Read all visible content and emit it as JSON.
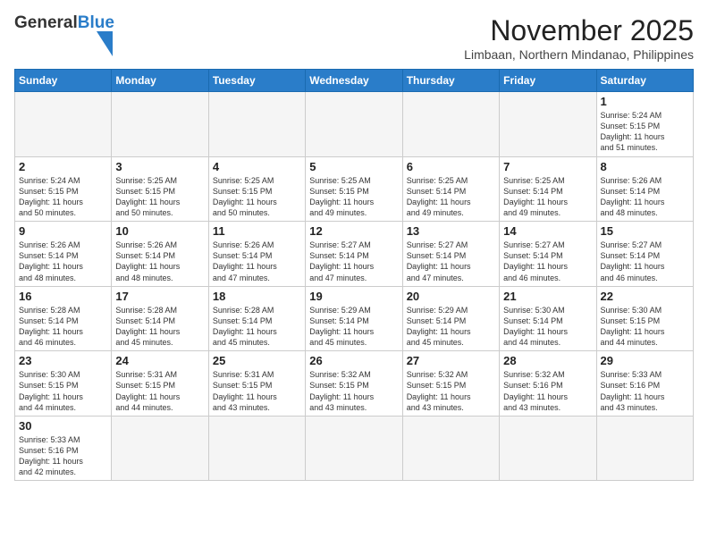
{
  "header": {
    "logo_general": "General",
    "logo_blue": "Blue",
    "month_title": "November 2025",
    "location": "Limbaan, Northern Mindanao, Philippines"
  },
  "weekdays": [
    "Sunday",
    "Monday",
    "Tuesday",
    "Wednesday",
    "Thursday",
    "Friday",
    "Saturday"
  ],
  "weeks": [
    [
      {
        "day": "",
        "info": ""
      },
      {
        "day": "",
        "info": ""
      },
      {
        "day": "",
        "info": ""
      },
      {
        "day": "",
        "info": ""
      },
      {
        "day": "",
        "info": ""
      },
      {
        "day": "",
        "info": ""
      },
      {
        "day": "1",
        "info": "Sunrise: 5:24 AM\nSunset: 5:15 PM\nDaylight: 11 hours\nand 51 minutes."
      }
    ],
    [
      {
        "day": "2",
        "info": "Sunrise: 5:24 AM\nSunset: 5:15 PM\nDaylight: 11 hours\nand 50 minutes."
      },
      {
        "day": "3",
        "info": "Sunrise: 5:25 AM\nSunset: 5:15 PM\nDaylight: 11 hours\nand 50 minutes."
      },
      {
        "day": "4",
        "info": "Sunrise: 5:25 AM\nSunset: 5:15 PM\nDaylight: 11 hours\nand 50 minutes."
      },
      {
        "day": "5",
        "info": "Sunrise: 5:25 AM\nSunset: 5:15 PM\nDaylight: 11 hours\nand 49 minutes."
      },
      {
        "day": "6",
        "info": "Sunrise: 5:25 AM\nSunset: 5:14 PM\nDaylight: 11 hours\nand 49 minutes."
      },
      {
        "day": "7",
        "info": "Sunrise: 5:25 AM\nSunset: 5:14 PM\nDaylight: 11 hours\nand 49 minutes."
      },
      {
        "day": "8",
        "info": "Sunrise: 5:26 AM\nSunset: 5:14 PM\nDaylight: 11 hours\nand 48 minutes."
      }
    ],
    [
      {
        "day": "9",
        "info": "Sunrise: 5:26 AM\nSunset: 5:14 PM\nDaylight: 11 hours\nand 48 minutes."
      },
      {
        "day": "10",
        "info": "Sunrise: 5:26 AM\nSunset: 5:14 PM\nDaylight: 11 hours\nand 48 minutes."
      },
      {
        "day": "11",
        "info": "Sunrise: 5:26 AM\nSunset: 5:14 PM\nDaylight: 11 hours\nand 47 minutes."
      },
      {
        "day": "12",
        "info": "Sunrise: 5:27 AM\nSunset: 5:14 PM\nDaylight: 11 hours\nand 47 minutes."
      },
      {
        "day": "13",
        "info": "Sunrise: 5:27 AM\nSunset: 5:14 PM\nDaylight: 11 hours\nand 47 minutes."
      },
      {
        "day": "14",
        "info": "Sunrise: 5:27 AM\nSunset: 5:14 PM\nDaylight: 11 hours\nand 46 minutes."
      },
      {
        "day": "15",
        "info": "Sunrise: 5:27 AM\nSunset: 5:14 PM\nDaylight: 11 hours\nand 46 minutes."
      }
    ],
    [
      {
        "day": "16",
        "info": "Sunrise: 5:28 AM\nSunset: 5:14 PM\nDaylight: 11 hours\nand 46 minutes."
      },
      {
        "day": "17",
        "info": "Sunrise: 5:28 AM\nSunset: 5:14 PM\nDaylight: 11 hours\nand 45 minutes."
      },
      {
        "day": "18",
        "info": "Sunrise: 5:28 AM\nSunset: 5:14 PM\nDaylight: 11 hours\nand 45 minutes."
      },
      {
        "day": "19",
        "info": "Sunrise: 5:29 AM\nSunset: 5:14 PM\nDaylight: 11 hours\nand 45 minutes."
      },
      {
        "day": "20",
        "info": "Sunrise: 5:29 AM\nSunset: 5:14 PM\nDaylight: 11 hours\nand 45 minutes."
      },
      {
        "day": "21",
        "info": "Sunrise: 5:30 AM\nSunset: 5:14 PM\nDaylight: 11 hours\nand 44 minutes."
      },
      {
        "day": "22",
        "info": "Sunrise: 5:30 AM\nSunset: 5:15 PM\nDaylight: 11 hours\nand 44 minutes."
      }
    ],
    [
      {
        "day": "23",
        "info": "Sunrise: 5:30 AM\nSunset: 5:15 PM\nDaylight: 11 hours\nand 44 minutes."
      },
      {
        "day": "24",
        "info": "Sunrise: 5:31 AM\nSunset: 5:15 PM\nDaylight: 11 hours\nand 44 minutes."
      },
      {
        "day": "25",
        "info": "Sunrise: 5:31 AM\nSunset: 5:15 PM\nDaylight: 11 hours\nand 43 minutes."
      },
      {
        "day": "26",
        "info": "Sunrise: 5:32 AM\nSunset: 5:15 PM\nDaylight: 11 hours\nand 43 minutes."
      },
      {
        "day": "27",
        "info": "Sunrise: 5:32 AM\nSunset: 5:15 PM\nDaylight: 11 hours\nand 43 minutes."
      },
      {
        "day": "28",
        "info": "Sunrise: 5:32 AM\nSunset: 5:16 PM\nDaylight: 11 hours\nand 43 minutes."
      },
      {
        "day": "29",
        "info": "Sunrise: 5:33 AM\nSunset: 5:16 PM\nDaylight: 11 hours\nand 43 minutes."
      }
    ],
    [
      {
        "day": "30",
        "info": "Sunrise: 5:33 AM\nSunset: 5:16 PM\nDaylight: 11 hours\nand 42 minutes."
      },
      {
        "day": "",
        "info": ""
      },
      {
        "day": "",
        "info": ""
      },
      {
        "day": "",
        "info": ""
      },
      {
        "day": "",
        "info": ""
      },
      {
        "day": "",
        "info": ""
      },
      {
        "day": "",
        "info": ""
      }
    ]
  ]
}
